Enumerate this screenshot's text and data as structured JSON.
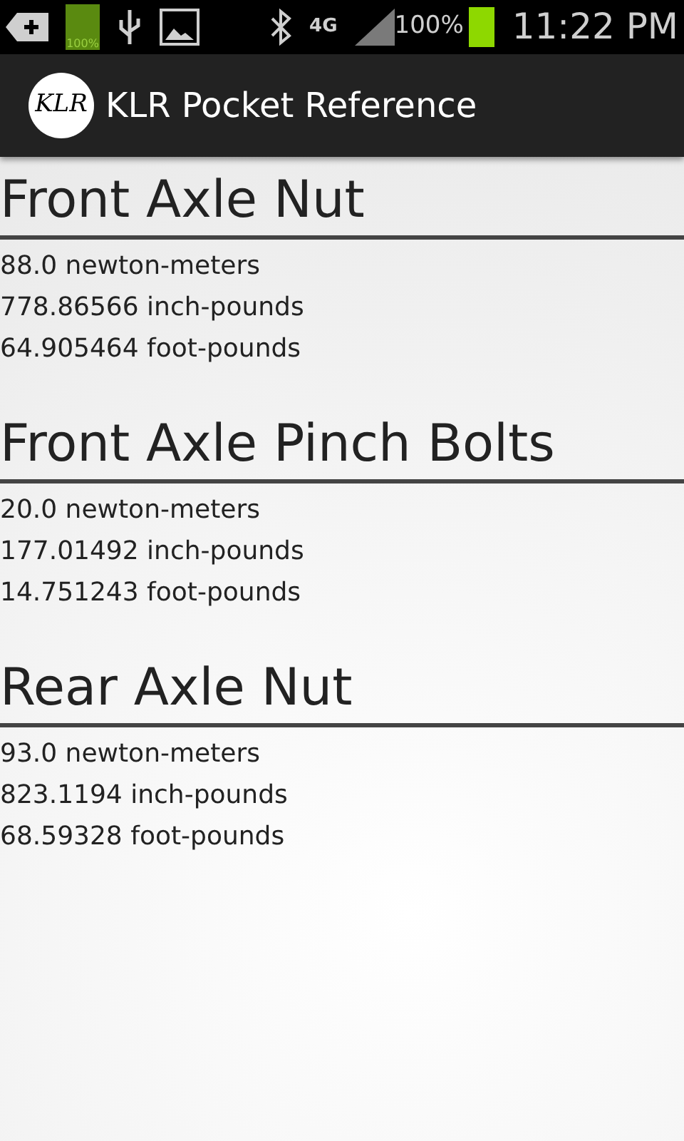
{
  "status_bar": {
    "battery_notice": "100%",
    "network": "4G",
    "battery": "100%",
    "time": "11:22 PM"
  },
  "app_bar": {
    "logo": "KLR",
    "title": "KLR Pocket Reference"
  },
  "sections": [
    {
      "title": "Front Axle Nut",
      "lines": [
        "88.0 newton-meters",
        "778.86566 inch-pounds",
        "64.905464 foot-pounds"
      ]
    },
    {
      "title": "Front Axle Pinch Bolts",
      "lines": [
        "20.0 newton-meters",
        "177.01492 inch-pounds",
        "14.751243 foot-pounds"
      ]
    },
    {
      "title": "Rear Axle Nut",
      "lines": [
        "93.0 newton-meters",
        "823.1194 inch-pounds",
        "68.59328 foot-pounds"
      ]
    }
  ]
}
